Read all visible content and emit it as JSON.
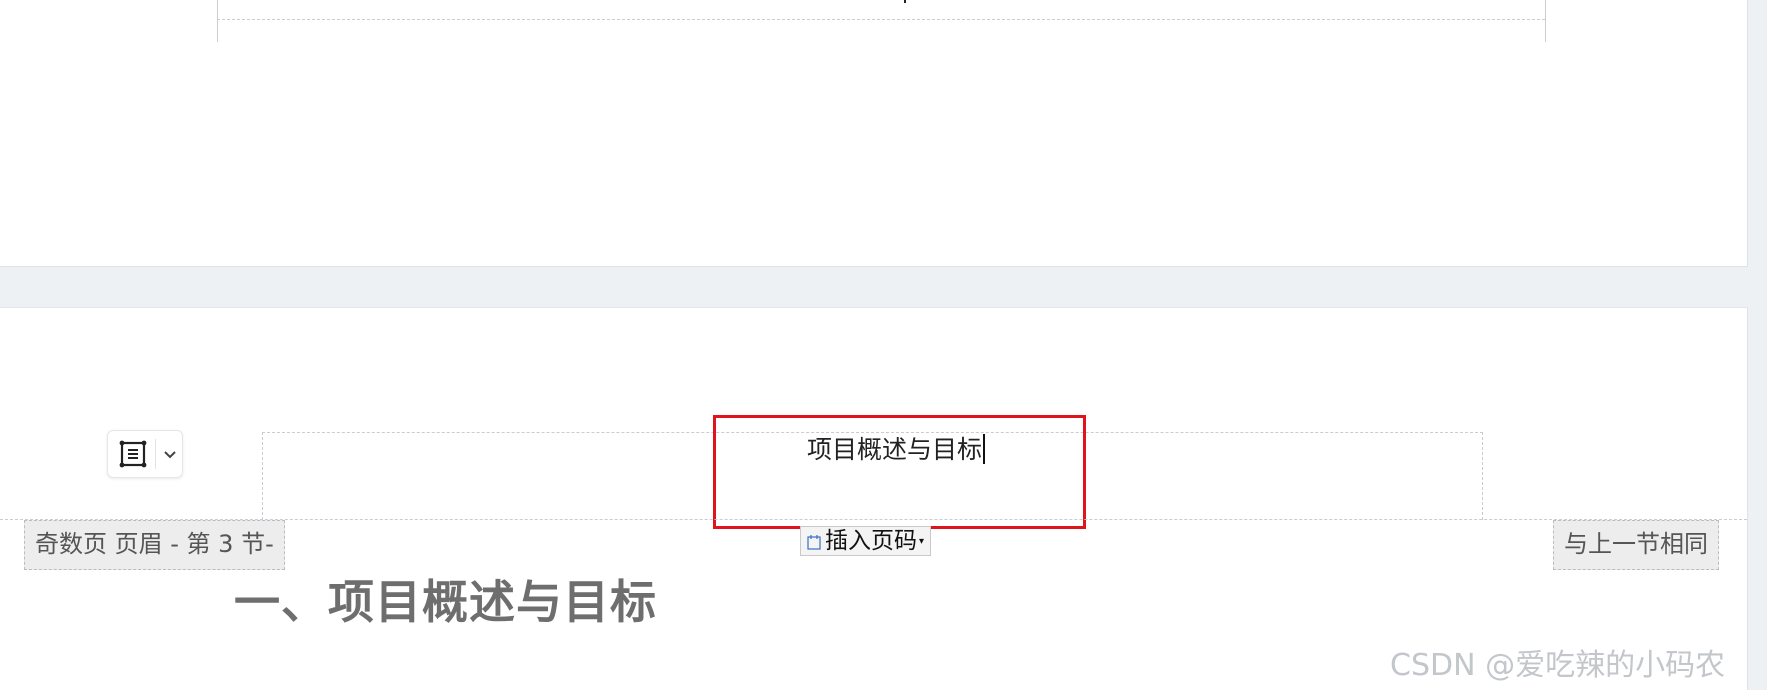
{
  "header_editor": {
    "text": "项目概述与目标",
    "left_tag": "奇数页 页眉  - 第 3 节-",
    "right_tag": "与上一节相同",
    "insert_page_number_label": "插入页码",
    "insert_page_number_arrow": "▾"
  },
  "toolbar": {
    "frame_icon": "frame-select-icon",
    "dropdown_icon": "chevron-down-icon"
  },
  "document": {
    "heading": "一、项目概述与目标"
  },
  "watermark": "CSDN @爱吃辣的小码农",
  "colors": {
    "highlight": "#e0141c",
    "canvas": "#eef1f4",
    "page": "#ffffff"
  }
}
